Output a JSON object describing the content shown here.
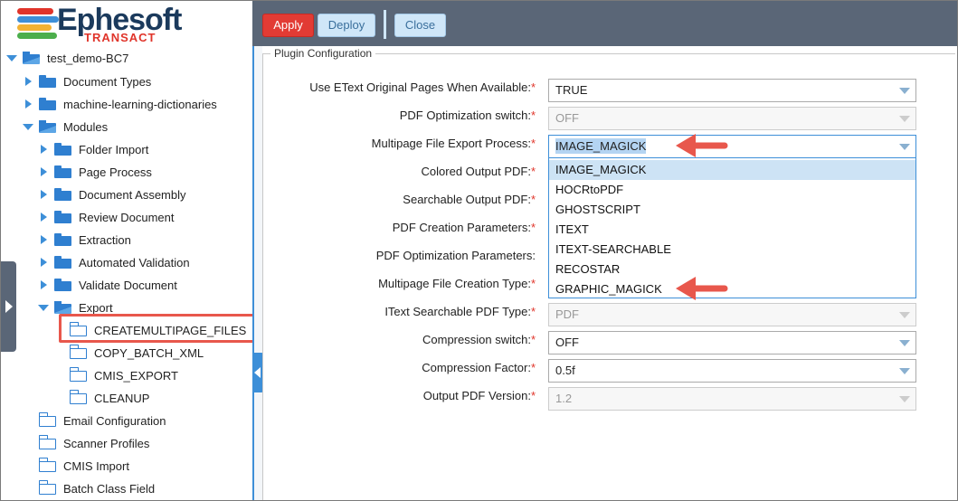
{
  "app": {
    "logo_main": "Ephesoft",
    "logo_sub": "TRANSACT",
    "colors": {
      "accent": "#3d8fd8",
      "apply": "#e23b34",
      "topbar": "#5a6677",
      "brand_red": "#e0342a"
    }
  },
  "toolbar": {
    "apply": "Apply",
    "deploy": "Deploy",
    "close": "Close"
  },
  "tree": {
    "root": "test_demo-BC7",
    "items": [
      {
        "label": "Document Types"
      },
      {
        "label": "machine-learning-dictionaries"
      },
      {
        "label": "Modules"
      },
      {
        "label": "Folder Import"
      },
      {
        "label": "Page Process"
      },
      {
        "label": "Document Assembly"
      },
      {
        "label": "Review Document"
      },
      {
        "label": "Extraction"
      },
      {
        "label": "Automated Validation"
      },
      {
        "label": "Validate Document"
      },
      {
        "label": "Export"
      },
      {
        "label": "CREATEMULTIPAGE_FILES"
      },
      {
        "label": "COPY_BATCH_XML"
      },
      {
        "label": "CMIS_EXPORT"
      },
      {
        "label": "CLEANUP"
      },
      {
        "label": "Email Configuration"
      },
      {
        "label": "Scanner Profiles"
      },
      {
        "label": "CMIS Import"
      },
      {
        "label": "Batch Class Field"
      }
    ]
  },
  "config": {
    "legend": "Plugin Configuration",
    "required_mark": "*",
    "fields": [
      {
        "label": "Use EText Original Pages When Available:",
        "value": "TRUE"
      },
      {
        "label": "PDF Optimization switch:",
        "value": "OFF"
      },
      {
        "label": "Multipage File Export Process:",
        "value": "IMAGE_MAGICK"
      },
      {
        "label": "Colored Output PDF:",
        "value": ""
      },
      {
        "label": "Searchable Output PDF:",
        "value": ""
      },
      {
        "label": "PDF Creation Parameters:",
        "value": ""
      },
      {
        "label": "PDF Optimization Parameters:",
        "value": ""
      },
      {
        "label": "Multipage File Creation Type:",
        "value": ""
      },
      {
        "label": "IText Searchable PDF Type:",
        "value": "PDF"
      },
      {
        "label": "Compression switch:",
        "value": "OFF"
      },
      {
        "label": "Compression Factor:",
        "value": "0.5f"
      },
      {
        "label": "Output PDF Version:",
        "value": "1.2"
      }
    ],
    "dropdown_options": [
      "IMAGE_MAGICK",
      "HOCRtoPDF",
      "GHOSTSCRIPT",
      "ITEXT",
      "ITEXT-SEARCHABLE",
      "RECOSTAR",
      "GRAPHIC_MAGICK"
    ]
  }
}
